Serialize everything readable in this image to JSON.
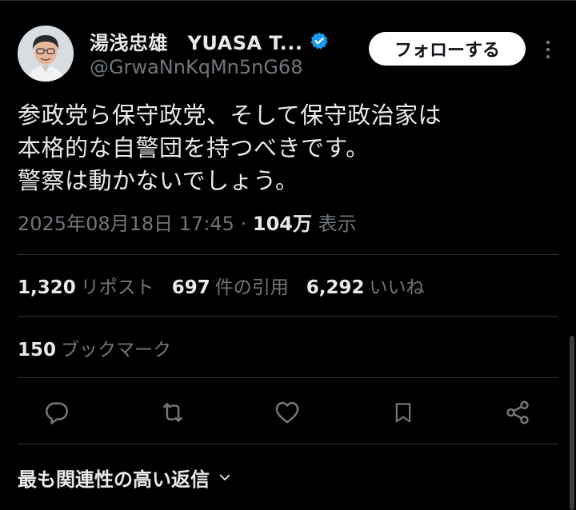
{
  "tweet": {
    "author_name": "湯浅忠雄　YUASA T...",
    "author_handle": "@GrwaNnKqMn5nG68",
    "follow_label": "フォローする",
    "text_lines": [
      "参政党ら保守政党、そして保守政治家は",
      "本格的な自警団を持つべきです。",
      "警察は動かないでしょう。"
    ],
    "timestamp": "2025年08月18日 17:45",
    "separator": "·",
    "views_count": "104万",
    "views_label": "表示"
  },
  "stats": {
    "reposts_count": "1,320",
    "reposts_label": "リポスト",
    "quotes_count": "697",
    "quotes_label": "件の引用",
    "likes_count": "6,292",
    "likes_label": "いいね",
    "bookmarks_count": "150",
    "bookmarks_label": "ブックマーク"
  },
  "replies": {
    "sort_label": "最も関連性の高い返信"
  },
  "colors": {
    "background": "#000000",
    "text_primary": "#e7e9ea",
    "text_secondary": "#71767b",
    "divider": "#2f3336",
    "verified": "#1d9bf0",
    "follow_bg": "#ffffff"
  },
  "icons": {
    "verified": "verified-badge-icon",
    "more": "more-vertical-icon",
    "reply": "reply-icon",
    "repost": "repost-icon",
    "like": "heart-icon",
    "bookmark": "bookmark-icon",
    "share": "share-icon",
    "chevron": "chevron-down-icon"
  }
}
